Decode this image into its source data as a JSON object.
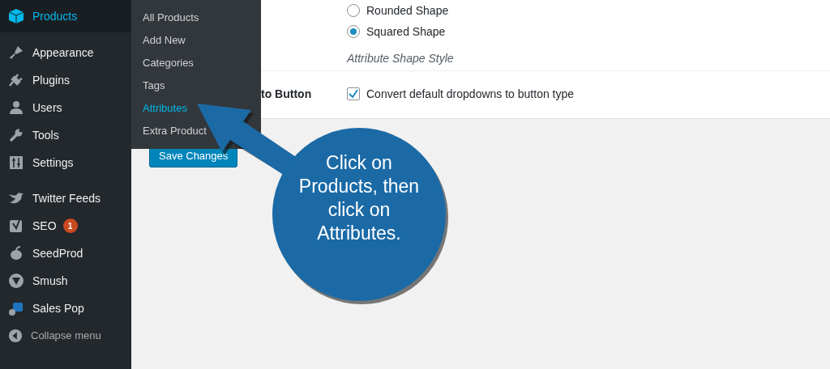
{
  "sidebar": {
    "items": [
      {
        "label": "Products",
        "selected": true
      },
      {
        "label": "Appearance",
        "selected": false
      },
      {
        "label": "Plugins",
        "selected": false
      },
      {
        "label": "Users",
        "selected": false
      },
      {
        "label": "Tools",
        "selected": false
      },
      {
        "label": "Settings",
        "selected": false
      },
      {
        "label": "Twitter Feeds",
        "selected": false
      },
      {
        "label": "SEO",
        "selected": false,
        "badge": "1"
      },
      {
        "label": "SeedProd",
        "selected": false
      },
      {
        "label": "Smush",
        "selected": false
      },
      {
        "label": "Sales Pop",
        "selected": false
      }
    ],
    "collapse_menu": "Collapse menu"
  },
  "submenu": {
    "items": [
      {
        "label": "All Products",
        "selected": false
      },
      {
        "label": "Add New",
        "selected": false
      },
      {
        "label": "Categories",
        "selected": false
      },
      {
        "label": "Tags",
        "selected": false
      },
      {
        "label": "Attributes",
        "selected": true
      },
      {
        "label": "Extra Product",
        "selected": false
      }
    ]
  },
  "settings": {
    "radio_options": [
      {
        "label": "Rounded Shape",
        "selected": false
      },
      {
        "label": "Squared Shape",
        "selected": true
      }
    ],
    "description": "Attribute Shape Style",
    "checkbox_row": {
      "section_label": "to Button",
      "label": "Convert default dropdowns to button type",
      "checked": true
    },
    "save_button": "Save Changes"
  },
  "callout": {
    "text": "Click on Products, then click on Attributes."
  }
}
